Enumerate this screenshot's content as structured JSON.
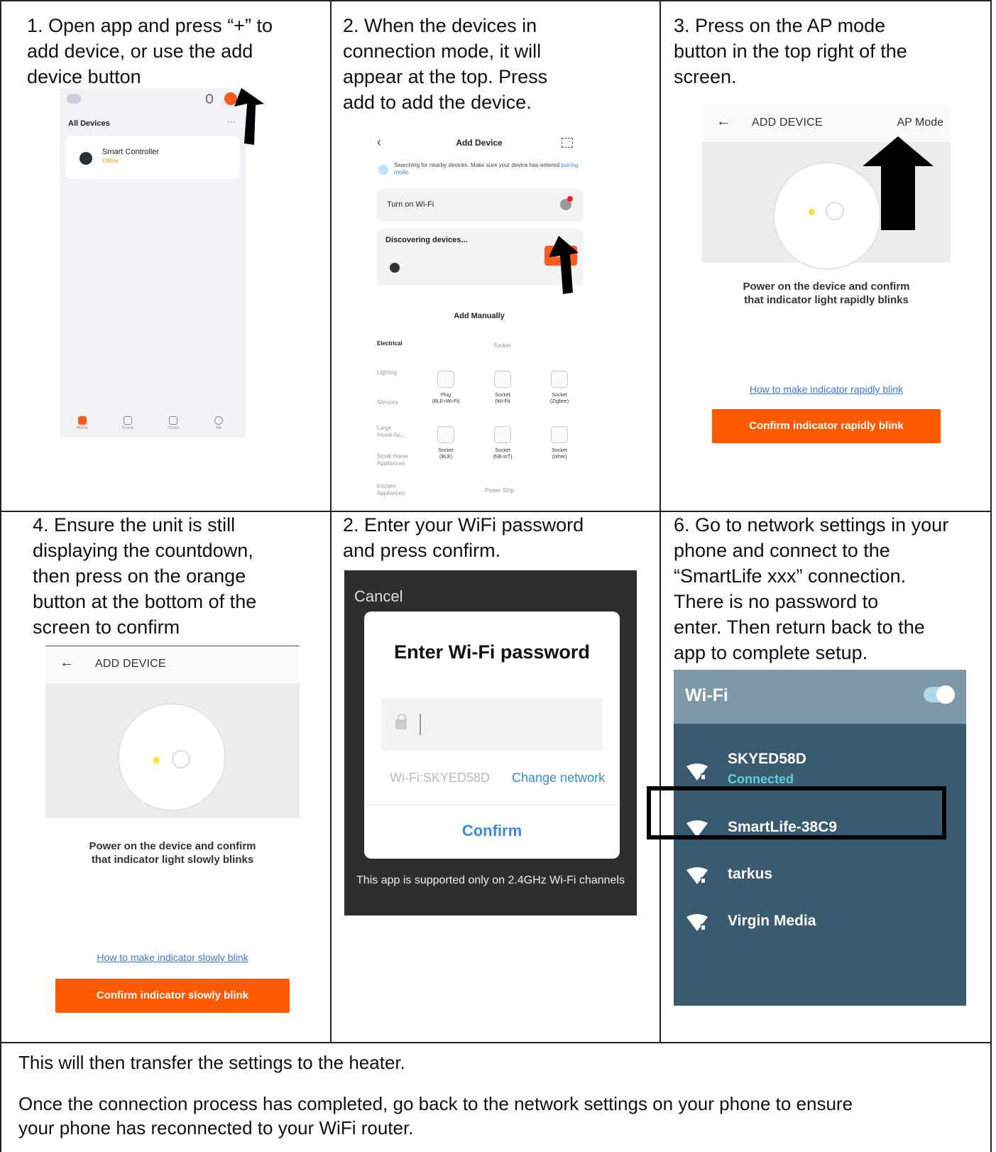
{
  "steps": {
    "s1": "1.  Open app and press “+” to\nadd device, or use the add\ndevice button",
    "s2": "2.  When the devices in\n      connection mode, it will\n      appear at the top. Press\n      add to add the device.",
    "s3": "3.  Press on the AP mode\n      button in the top right of the\n      screen.",
    "s4": "4. Ensure the unit is still\n     displaying the countdown,\n     then press on the orange\n     button at the bottom of the\n     screen to confirm",
    "s5": "2.  Enter your WiFi password\n      and press confirm.",
    "s6": "6. Go to network settings in your\n     phone and connect to the\n     “SmartLife xxx” connection.\n     There is no password to\n     enter. Then return back to the\n     app to complete setup."
  },
  "footer": {
    "line1": "This will then transfer the settings to the heater.",
    "line2": "Once the connection process has completed, go back to the network settings on your phone to ensure",
    "line3": "your phone has reconnected to your WiFi router."
  },
  "phone1": {
    "all_devices": "All Devices",
    "more": "···",
    "device_name": "Smart Controller",
    "device_status": "Offline",
    "nav": [
      "Home",
      "Scene",
      "Smart",
      "Me"
    ]
  },
  "phone2": {
    "title": "Add Device",
    "searching": "Searching for nearby devices. Make sure your device has entered",
    "pairing_link": "pairing mode.",
    "turn_on_wifi": "Turn on Wi-Fi",
    "discovering": "Discovering devices...",
    "add_btn": "Ad",
    "add_manually": "Add Manually",
    "categories": [
      "Electrical",
      "Lighting",
      "Sensors",
      "Large\nHome Ap...",
      "Small Home\nAppliances",
      "Kitchen\nAppliances"
    ],
    "socket_header": "Socket",
    "power_strip": "Power Strip",
    "products": [
      "Plug\n(BLE+Wi-Fi)",
      "Socket\n(Wi-Fi)",
      "Socket\n(Zigbee)",
      "Socket\n(BLE)",
      "Socket\n(NB-IoT)",
      "Socket\n(other)"
    ]
  },
  "phone3": {
    "header": "ADD DEVICE",
    "ap_mode": "AP Mode",
    "message": "Power on the device and confirm\nthat indicator light rapidly blinks",
    "how_link": "How to make indicator rapidly blink",
    "confirm_btn": "Confirm indicator rapidly blink"
  },
  "phone4": {
    "header": "ADD DEVICE",
    "message": "Power on the device and confirm\nthat indicator light slowly blinks",
    "how_link": "How to make indicator slowly blink",
    "confirm_btn": "Confirm indicator slowly blink"
  },
  "phone5": {
    "cancel": "Cancel",
    "title": "Enter Wi-Fi password",
    "ssid": "Wi-Fi:SKYED58D",
    "change_network": "Change network",
    "confirm": "Confirm",
    "note": "This app is supported only on 2.4GHz Wi-Fi channels"
  },
  "phone6": {
    "title": "Wi-Fi",
    "networks": [
      {
        "name": "SKYED58D",
        "status": "Connected"
      },
      {
        "name": "SmartLife-38C9",
        "status": ""
      },
      {
        "name": "tarkus",
        "status": ""
      },
      {
        "name": "Virgin Media",
        "status": ""
      }
    ]
  },
  "colors": {
    "accent_orange": "#ff5a00",
    "link_blue": "#3b8ad8",
    "wifi_panel": "#3a5a70"
  }
}
